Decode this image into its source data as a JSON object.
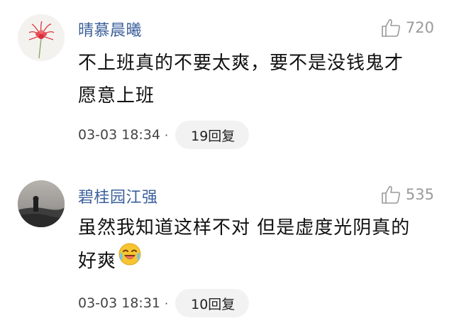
{
  "comments": [
    {
      "username": "晴慕晨曦",
      "likes": "720",
      "text_lines": [
        "不上班真的不要太爽，要不是没钱鬼才",
        "愿意上班"
      ],
      "timestamp": "03-03 18:34",
      "reply_label": "19回复",
      "avatar_icon": "red-flower-icon"
    },
    {
      "username": "碧桂园江强",
      "likes": "535",
      "text_lines": [
        "虽然我知道这样不对 但是虚度光阴真的",
        "好爽"
      ],
      "timestamp": "03-03 18:31",
      "reply_label": "10回复",
      "avatar_icon": "sunset-coast-photo",
      "emoji": "laughing-crying-emoji"
    }
  ],
  "separator": "·",
  "colors": {
    "username": "#3b5f9a",
    "like": "#9a9a9a",
    "reply_bg": "#f2f2f2"
  }
}
